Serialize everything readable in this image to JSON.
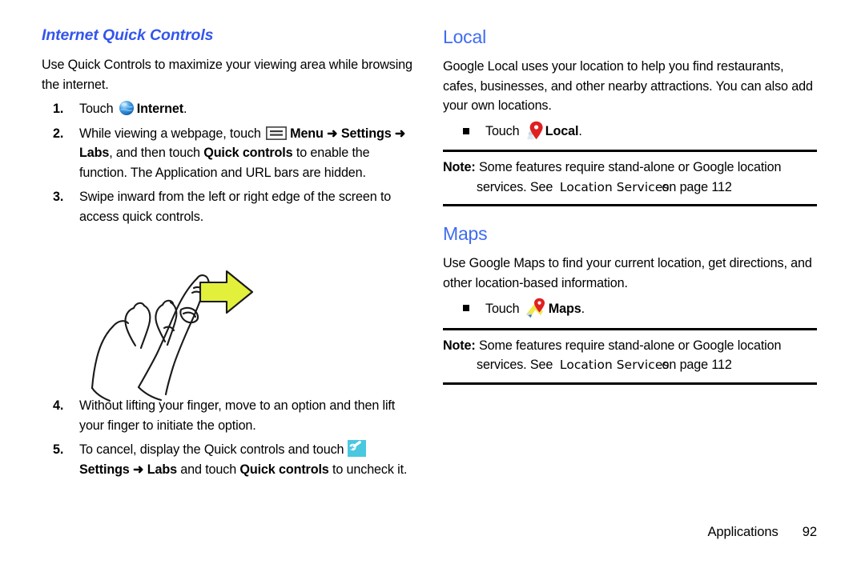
{
  "document": {
    "footer": {
      "section_name": "Applications",
      "page_number": "92"
    }
  },
  "left_column": {
    "heading": "Internet Quick Controls",
    "intro": "Use Quick Controls to maximize your viewing area while browsing the internet.",
    "steps": [
      {
        "number": "1.",
        "parts": [
          {
            "text": "Touch ",
            "bold": false
          },
          {
            "icon": "internet-globe-icon"
          },
          {
            "text": "Internet",
            "bold": true
          },
          {
            "text": ".",
            "bold": false
          }
        ]
      },
      {
        "number": "2.",
        "parts": [
          {
            "text": "While viewing a webpage, touch ",
            "bold": false
          },
          {
            "icon": "menu-icon"
          },
          {
            "text": "Menu",
            "bold": true
          },
          {
            "text": " ➜ ",
            "bold": true
          },
          {
            "text": "Settings ➜ Labs",
            "bold": true
          },
          {
            "text": ", and then touch ",
            "bold": false
          },
          {
            "text": "Quick controls",
            "bold": true
          },
          {
            "text": " to enable the function. The Application and URL bars are hidden.",
            "bold": false
          }
        ]
      },
      {
        "number": "3.",
        "parts": [
          {
            "text": "Swipe inward from the left or right edge of the screen to access quick controls.",
            "bold": false
          }
        ]
      },
      {
        "number": "4.",
        "parts": [
          {
            "text": "Without lifting your finger, move to an option and then lift your finger to initiate the option.",
            "bold": false
          }
        ]
      },
      {
        "number": "5.",
        "parts": [
          {
            "text": "To cancel, display the Quick controls and touch ",
            "bold": false
          },
          {
            "icon": "settings-wrench-icon"
          },
          {
            "text": "Settings ➜ Labs",
            "bold": true
          },
          {
            "text": " and touch ",
            "bold": false
          },
          {
            "text": "Quick controls",
            "bold": true
          },
          {
            "text": " to uncheck it.",
            "bold": false
          }
        ]
      }
    ],
    "illustration": {
      "name": "hand-swipe-illustration",
      "arrow_color": "#E2F03C",
      "outline_color": "#1a1a1a"
    }
  },
  "right_column": {
    "sections": [
      {
        "heading": "Local",
        "body": "Google Local uses your location to help you find restaurants, cafes, businesses, and other nearby attractions. You can also add your own locations.",
        "bullet": {
          "lead": "Touch ",
          "icon": "local-pin-icon",
          "label": "Local",
          "trail": "."
        },
        "note": {
          "label": "Note:",
          "line1": "Some features require stand-alone or Google location",
          "line2_lead": "services. See",
          "line2_xref": "Location Services",
          "line2_tail": "on page 112"
        }
      },
      {
        "heading": "Maps",
        "body": "Use Google Maps to find your current location, get directions, and other location-based information.",
        "bullet": {
          "lead": "Touch ",
          "icon": "maps-icon",
          "label": "Maps",
          "trail": "."
        },
        "note": {
          "label": "Note:",
          "line1": "Some features require stand-alone or Google location",
          "line2_lead": "services. See",
          "line2_xref": "Location Services",
          "line2_tail": "on page 112"
        }
      }
    ]
  },
  "colors": {
    "heading_blue_italic": "#3355EE",
    "heading_blue": "#3F6CF0",
    "settings_icon_bg": "#4AC8E0",
    "pin_red": "#E02020",
    "maps_yellow": "#EFE84A",
    "arrow_yellow": "#E2F03C",
    "text_black": "#000000"
  }
}
